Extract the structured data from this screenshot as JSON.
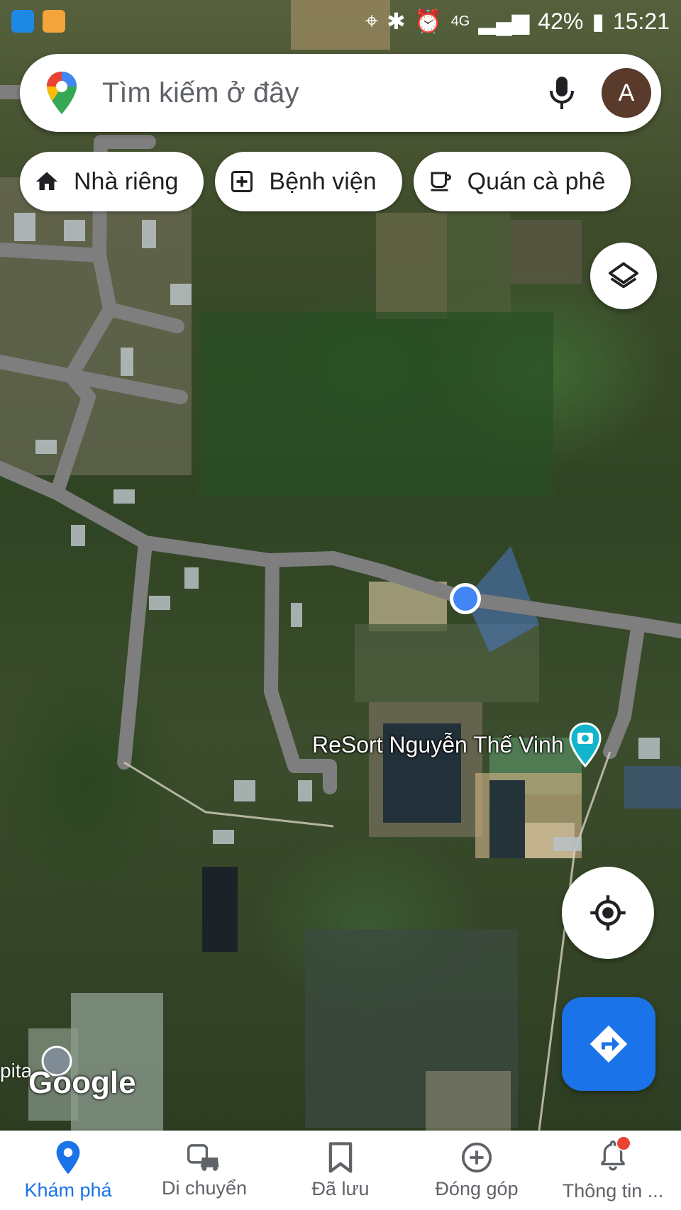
{
  "status_bar": {
    "battery": "42%",
    "time": "15:21",
    "network": "4G"
  },
  "search": {
    "placeholder": "Tìm kiếm ở đây",
    "avatar_letter": "A"
  },
  "chips": [
    {
      "label": "Nhà riêng",
      "icon": "home-icon"
    },
    {
      "label": "Bệnh viện",
      "icon": "hospital-icon"
    },
    {
      "label": "Quán cà phê",
      "icon": "coffee-icon"
    }
  ],
  "map": {
    "poi_label": "ReSort Nguyễn Thế Vinh",
    "poi_partial_label": "pita",
    "watermark": "Google",
    "colors": {
      "road": "#8d8d8d",
      "location_dot": "#4285f4",
      "poi_pin": "#12b5cb"
    }
  },
  "bottom_nav": [
    {
      "label": "Khám phá",
      "icon": "explore-pin-icon",
      "active": true
    },
    {
      "label": "Di chuyển",
      "icon": "commute-icon",
      "active": false
    },
    {
      "label": "Đã lưu",
      "icon": "bookmark-icon",
      "active": false
    },
    {
      "label": "Đóng góp",
      "icon": "add-circle-icon",
      "active": false
    },
    {
      "label": "Thông tin ...",
      "icon": "notifications-icon",
      "active": false
    }
  ],
  "accent_color": "#1a73e8"
}
